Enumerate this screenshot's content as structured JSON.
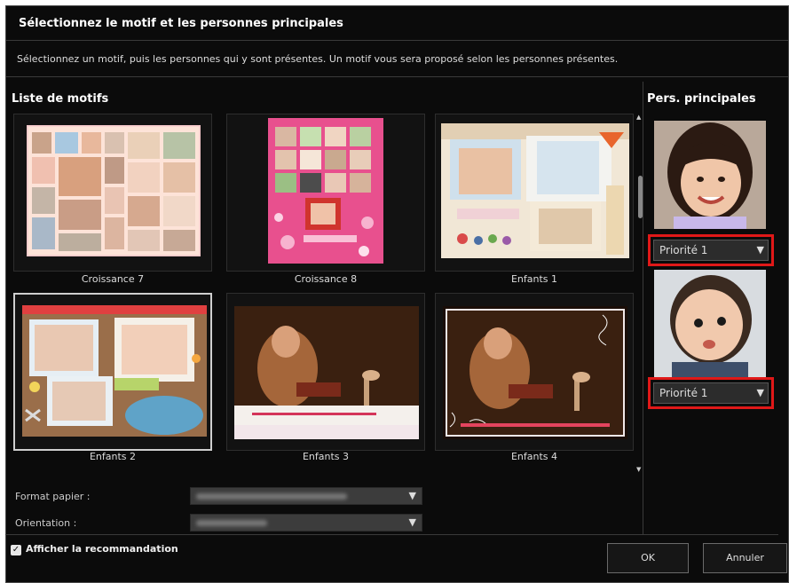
{
  "dialog": {
    "title": "Sélectionnez le motif et les personnes principales",
    "description": "Sélectionnez un motif, puis les personnes qui y sont présentes. Un motif vous sera proposé selon les personnes présentes."
  },
  "motifs": {
    "section_label": "Liste de motifs",
    "items": [
      {
        "label": "Croissance 7"
      },
      {
        "label": "Croissance 8"
      },
      {
        "label": "Enfants 1"
      },
      {
        "label": "Enfants 2",
        "selected": true
      },
      {
        "label": "Enfants 3"
      },
      {
        "label": "Enfants 4"
      }
    ]
  },
  "form": {
    "paper_format_label": "Format papier :",
    "orientation_label": "Orientation :"
  },
  "persons": {
    "section_label": "Pers. principales",
    "items": [
      {
        "priority": "Priorité 1"
      },
      {
        "priority": "Priorité 1"
      }
    ]
  },
  "footer": {
    "show_recommendation_label": "Afficher la recommandation",
    "show_recommendation_checked": true,
    "ok_label": "OK",
    "cancel_label": "Annuler"
  },
  "colors": {
    "highlight": "#e01818",
    "background": "#0b0b0b"
  }
}
